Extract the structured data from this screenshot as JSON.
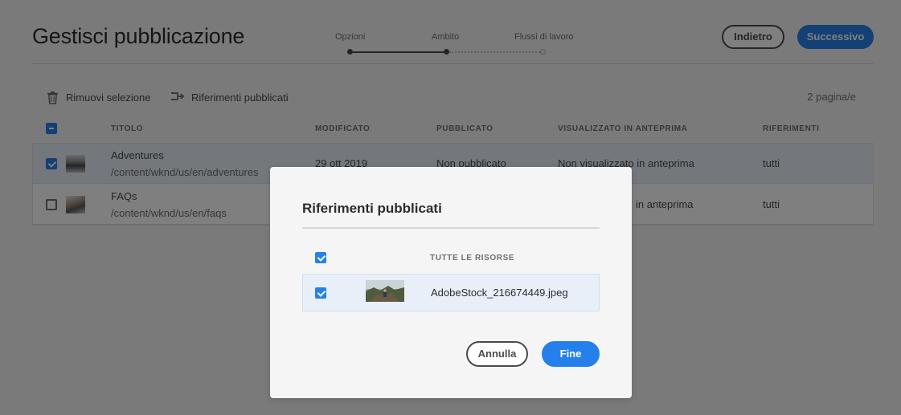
{
  "header": {
    "title": "Gestisci pubblicazione",
    "back_label": "Indietro",
    "next_label": "Successivo",
    "steps": [
      {
        "label": "Opzioni",
        "state": "done"
      },
      {
        "label": "Ambito",
        "state": "current"
      },
      {
        "label": "Flussi di lavoro",
        "state": "future"
      }
    ]
  },
  "toolbar": {
    "remove_label": "Rimuovi selezione",
    "remove_icon": "trash-icon",
    "refs_label": "Riferimenti pubblicati",
    "refs_icon": "references-icon",
    "page_count": "2 pagina/e"
  },
  "table": {
    "columns": {
      "title": "TITOLO",
      "modified": "MODIFICATO",
      "published": "PUBBLICATO",
      "previewed": "VISUALIZZATO IN ANTEPRIMA",
      "references": "RIFERIMENTI"
    },
    "rows": [
      {
        "checked": true,
        "title": "Adventures",
        "path": "/content/wknd/us/en/adventures",
        "modified": "29 ott 2019",
        "published": "Non pubblicato",
        "previewed": "Non visualizzato in anteprima",
        "references": "tutti"
      },
      {
        "checked": false,
        "title": "FAQs",
        "path": "/content/wknd/us/en/faqs",
        "modified": "",
        "published": "",
        "previewed": "in anteprima",
        "references": "tutti"
      }
    ]
  },
  "dialog": {
    "title": "Riferimenti pubblicati",
    "all_resources_label": "TUTTE LE RISORSE",
    "items": [
      {
        "name": "AdobeStock_216674449.jpeg",
        "checked": true
      }
    ],
    "cancel_label": "Annulla",
    "done_label": "Fine"
  },
  "colors": {
    "accent": "#2680eb",
    "overlay": "rgba(0,0,0,0.5)",
    "selected_row": "#e8eff8"
  }
}
